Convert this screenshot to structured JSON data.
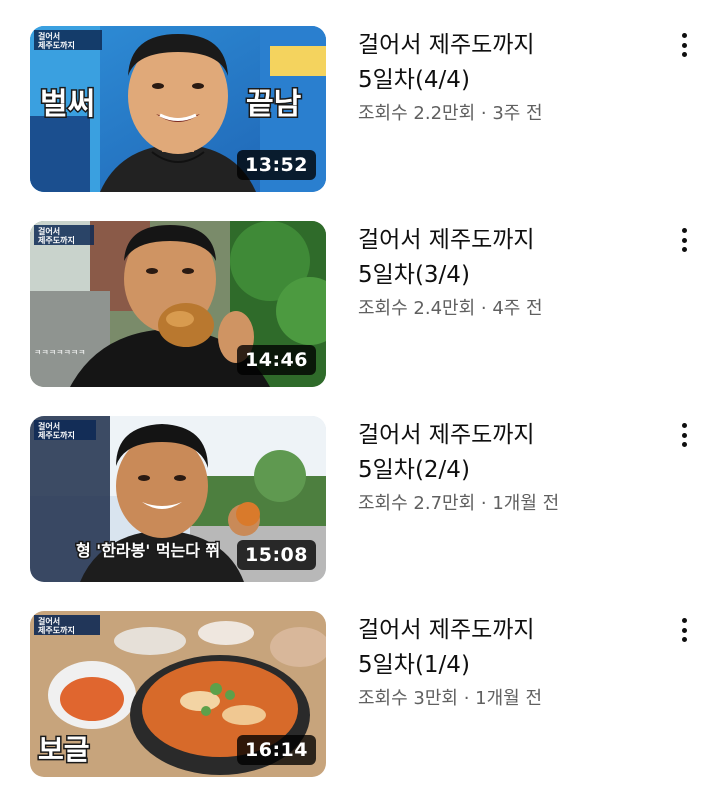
{
  "videos": [
    {
      "title_line1": "걸어서 제주도까지",
      "title_line2": "5일차(4/4)",
      "views": "조회수 2.2만회",
      "separator": " · ",
      "age": "3주 전",
      "duration": "13:52",
      "thumb_caption_left": "벌써",
      "thumb_caption_right": "끝남",
      "thumb_logo_line1": "걸어서",
      "thumb_logo_line2": "제주도까지"
    },
    {
      "title_line1": "걸어서 제주도까지",
      "title_line2": "5일차(3/4)",
      "views": "조회수 2.4만회",
      "separator": " · ",
      "age": "4주 전",
      "duration": "14:46",
      "thumb_chat": "ㅋㅋㅋㅋㅋㅋㅋ",
      "thumb_logo_line1": "걸어서",
      "thumb_logo_line2": "제주도까지"
    },
    {
      "title_line1": "걸어서 제주도까지",
      "title_line2": "5일차(2/4)",
      "views": "조회수 2.7만회",
      "separator": " · ",
      "age": "1개월 전",
      "duration": "15:08",
      "thumb_caption": "형 '한라봉' 먹는다 쮜",
      "thumb_logo_line1": "걸어서",
      "thumb_logo_line2": "제주도까지"
    },
    {
      "title_line1": "걸어서 제주도까지",
      "title_line2": "5일차(1/4)",
      "views": "조회수 3만회",
      "separator": " · ",
      "age": "1개월 전",
      "duration": "16:14",
      "thumb_caption_left": "보글",
      "thumb_logo_line1": "걸어서",
      "thumb_logo_line2": "제주도까지"
    }
  ],
  "icons": {
    "menu": "more-vertical-icon"
  }
}
